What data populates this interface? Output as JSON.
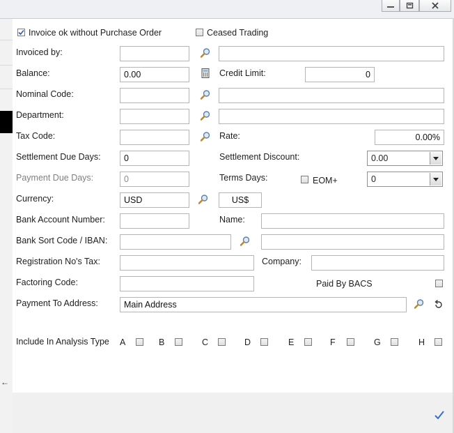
{
  "form": {
    "invoice_ok_label": "Invoice ok without Purchase Order",
    "invoice_ok_checked": true,
    "ceased_trading_label": "Ceased Trading",
    "ceased_trading_checked": false,
    "invoiced_by_label": "Invoiced by:",
    "invoiced_by_code": "",
    "invoiced_by_name": "",
    "balance_label": "Balance:",
    "balance_value": "0.00",
    "credit_limit_label": "Credit Limit:",
    "credit_limit_value": "0",
    "nominal_code_label": "Nominal Code:",
    "nominal_code_value": "",
    "nominal_code_desc": "",
    "department_label": "Department:",
    "department_value": "",
    "department_desc": "",
    "tax_code_label": "Tax Code:",
    "tax_code_value": "",
    "rate_label": "Rate:",
    "rate_value": "0.00%",
    "settlement_due_days_label": "Settlement Due Days:",
    "settlement_due_days_value": "0",
    "settlement_discount_label": "Settlement Discount:",
    "settlement_discount_value": "0.00",
    "payment_due_days_label": "Payment Due Days:",
    "payment_due_days_value": "0",
    "terms_days_label": "Terms Days:",
    "eom_label": "EOM+",
    "eom_checked": false,
    "terms_days_value": "0",
    "currency_label": "Currency:",
    "currency_value": "USD",
    "currency_symbol": "US$",
    "bank_account_number_label": "Bank Account Number:",
    "bank_account_number_value": "",
    "bank_name_label": "Name:",
    "bank_name_value": "",
    "bank_sort_code_label": "Bank Sort Code / IBAN:",
    "bank_sort_code_value": "",
    "bank_sort_code_desc": "",
    "registration_tax_label": "Registration No's Tax:",
    "registration_tax_value": "",
    "company_label": "Company:",
    "company_value": "",
    "factoring_code_label": "Factoring Code:",
    "factoring_code_value": "",
    "paid_by_bacs_label": "Paid By BACS",
    "paid_by_bacs_checked": false,
    "payment_to_address_label": "Payment To Address:",
    "payment_to_address_value": "Main Address",
    "analysis_type_label": "Include In Analysis Type",
    "analysis_types": [
      {
        "letter": "A",
        "checked": false
      },
      {
        "letter": "B",
        "checked": false
      },
      {
        "letter": "C",
        "checked": false
      },
      {
        "letter": "D",
        "checked": false
      },
      {
        "letter": "E",
        "checked": false
      },
      {
        "letter": "F",
        "checked": false
      },
      {
        "letter": "G",
        "checked": false
      },
      {
        "letter": "H",
        "checked": false
      }
    ]
  },
  "window": {
    "controls": [
      "minimize-icon",
      "restore-icon",
      "close-icon"
    ]
  },
  "icons": {
    "lookup": "magnifier-icon",
    "calculator": "calculator-icon",
    "undo": "undo-icon",
    "confirm": "checkmark-icon",
    "back": "arrow-left-icon"
  },
  "colors": {
    "background": "#ffffff",
    "footer": "#f0f0f0",
    "checkmark": "#3a6fc4",
    "border": "#b5b5b5"
  }
}
